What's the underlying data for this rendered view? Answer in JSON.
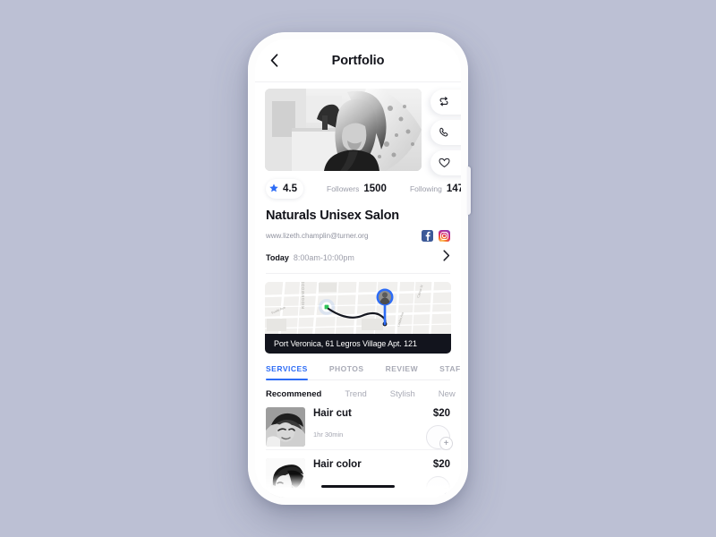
{
  "theme": {
    "background": "#bcc0d4",
    "accent": "#2d6cf6",
    "text_dark": "#12131a",
    "text_muted": "#9b9da9",
    "address_bar_bg": "#12141d"
  },
  "header": {
    "title": "Portfolio",
    "back_icon": "chevron-left-icon"
  },
  "actions": [
    {
      "name": "transfer-icon",
      "label": "Transfer"
    },
    {
      "name": "phone-icon",
      "label": "Call"
    },
    {
      "name": "heart-icon",
      "label": "Favorite"
    }
  ],
  "hero": {
    "alt": "salon-hairstyling-photo"
  },
  "stats": {
    "rating": "4.5",
    "star_icon": "star-icon",
    "followers_label": "Followers",
    "followers_value": "1500",
    "following_label": "Following",
    "following_value": "147"
  },
  "profile": {
    "name": "Naturals Unisex Salon",
    "url": "www.lizeth.champlin@turner.org",
    "socials": [
      {
        "name": "facebook-icon",
        "label": "Facebook"
      },
      {
        "name": "instagram-icon",
        "label": "Instagram"
      }
    ]
  },
  "hours": {
    "day": "Today",
    "time": "8:00am-10:00pm",
    "chevron": "chevron-right-icon"
  },
  "map": {
    "address": "Port Veronica, 61 Legros Village Apt. 121",
    "street_label": "RIDGEWOOD",
    "street_label_2": "Fowle Ave",
    "origin_marker": "origin-dot",
    "destination_marker": "map-pin-avatar"
  },
  "tabs": [
    {
      "label": "SERVICES",
      "active": true
    },
    {
      "label": "PHOTOS",
      "active": false
    },
    {
      "label": "REVIEW",
      "active": false
    },
    {
      "label": "STAFF",
      "active": false
    }
  ],
  "filters": [
    {
      "label": "Recommened",
      "active": true
    },
    {
      "label": "Trend",
      "active": false
    },
    {
      "label": "Stylish",
      "active": false
    },
    {
      "label": "New",
      "active": false
    }
  ],
  "services": [
    {
      "name": "Hair cut",
      "duration": "1hr 30min",
      "price": "$20",
      "add_label": "+",
      "thumb": "haircut-thumb"
    },
    {
      "name": "Hair color",
      "duration": "",
      "price": "$20",
      "add_label": "+",
      "thumb": "haircolor-thumb"
    }
  ]
}
